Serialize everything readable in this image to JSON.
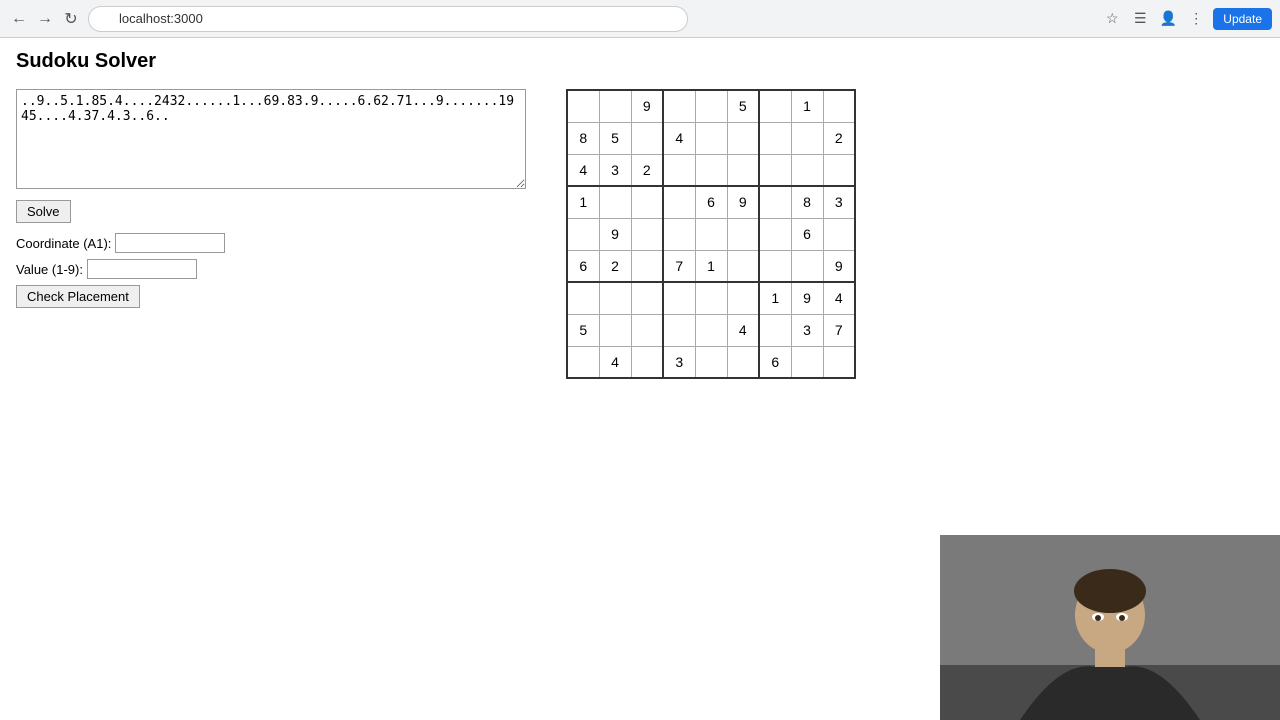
{
  "browser": {
    "url": "localhost:3000",
    "update_label": "Update"
  },
  "page": {
    "title": "Sudoku Solver"
  },
  "left_panel": {
    "textarea_value": "..9..5.1.85.4....2432......1...69.83.9.....6.62.71...9.......1945....4.37.4.3..6..",
    "solve_button": "Solve",
    "coordinate_label": "Coordinate (A1):",
    "coordinate_placeholder": "",
    "value_label": "Value (1-9):",
    "value_placeholder": "",
    "check_placement_button": "Check Placement"
  },
  "sudoku": {
    "grid": [
      [
        "",
        "",
        "9",
        "",
        "",
        "5",
        "",
        "1",
        ""
      ],
      [
        "8",
        "5",
        "",
        "4",
        "",
        "",
        "",
        "",
        "2"
      ],
      [
        "4",
        "3",
        "2",
        "",
        "",
        "",
        "",
        "",
        ""
      ],
      [
        "1",
        "",
        "",
        "",
        "6",
        "9",
        "",
        "8",
        "3"
      ],
      [
        "",
        "9",
        "",
        "",
        "",
        "",
        "",
        "6",
        ""
      ],
      [
        "6",
        "2",
        "",
        "7",
        "1",
        "",
        "",
        "",
        "9"
      ],
      [
        "",
        "",
        "",
        "",
        "",
        "",
        "1",
        "9",
        "4"
      ],
      [
        "5",
        "",
        "",
        "",
        "",
        "4",
        "",
        "3",
        "7"
      ],
      [
        "",
        "4",
        "",
        "3",
        "",
        "",
        "6",
        "",
        ""
      ]
    ]
  }
}
